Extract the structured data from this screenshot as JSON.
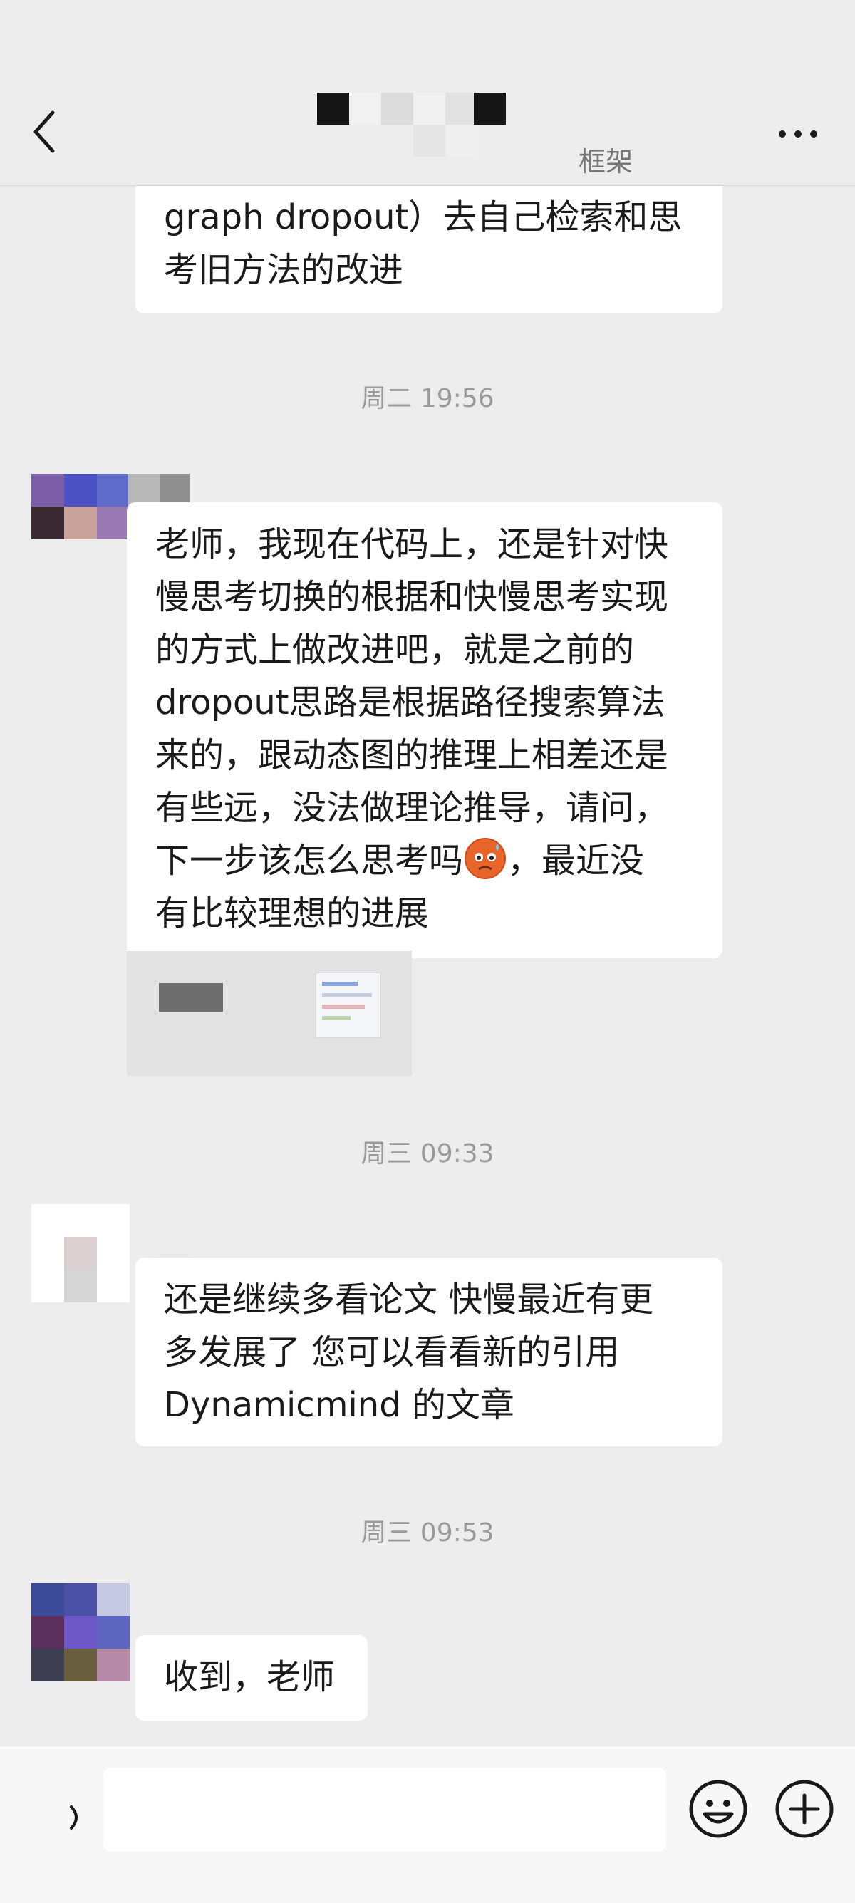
{
  "header": {
    "title_visible_fragment": "框架"
  },
  "messages": [
    {
      "id": "m0",
      "sender": "other",
      "lines": [
        "graph dropout）去自己检索和思",
        "考旧方法的改进"
      ]
    },
    {
      "id": "ts1",
      "type": "timestamp",
      "text": "周二 19:56"
    },
    {
      "id": "m1",
      "sender": "self",
      "lines": [
        "老师，我现在代码上，还是针对快",
        "慢思考切换的根据和快慢思考实现",
        "的方式上做改进吧，就是之前的",
        "dropout思路是根据路径搜索算法",
        "来的，跟动态图的推理上相差还是",
        "有些远，没法做理论推导，请问，",
        "下一步该怎么思考吗",
        "，最近没",
        "有比较理想的进展"
      ],
      "emoji_icon": "hot-face-emoji-icon"
    },
    {
      "id": "ts2",
      "type": "timestamp",
      "text": "周三 09:33"
    },
    {
      "id": "m2",
      "sender": "other",
      "lines": [
        "还是继续多看论文 快慢最近有更",
        "多发展了 您可以看看新的引用",
        "Dynamicmind 的文章"
      ]
    },
    {
      "id": "ts3",
      "type": "timestamp",
      "text": "周三 09:53"
    },
    {
      "id": "m3",
      "sender": "self",
      "lines": [
        "收到，老师"
      ]
    }
  ],
  "composer": {
    "placeholder": "",
    "value": ""
  },
  "colors": {
    "background": "#ededed",
    "bubble": "#ffffff",
    "timestamp": "#9b9b9b"
  }
}
